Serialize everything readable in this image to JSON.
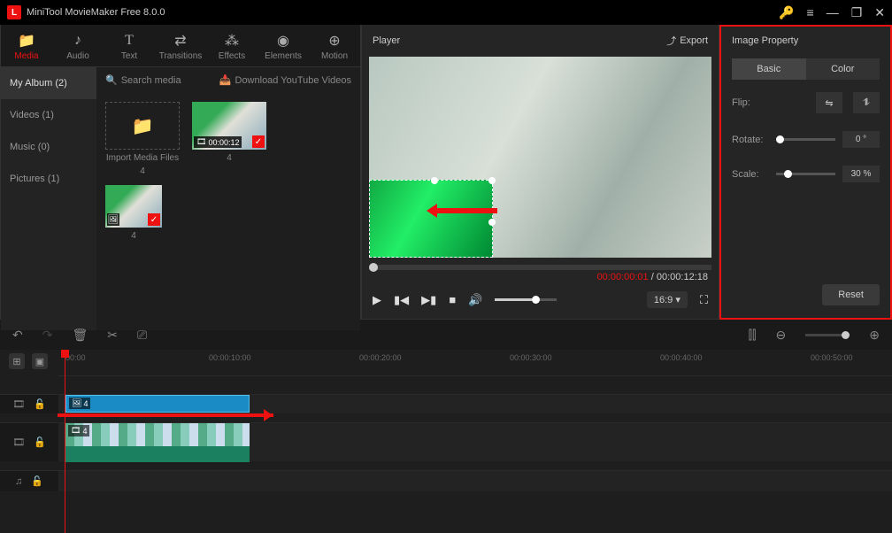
{
  "app": {
    "title": "MiniTool MovieMaker Free 8.0.0"
  },
  "toolbar_tabs": [
    {
      "id": "media",
      "label": "Media",
      "icon": "📁",
      "active": true
    },
    {
      "id": "audio",
      "label": "Audio",
      "icon": "♪"
    },
    {
      "id": "text",
      "label": "Text",
      "icon": "T"
    },
    {
      "id": "transitions",
      "label": "Transitions",
      "icon": "⇄"
    },
    {
      "id": "effects",
      "label": "Effects",
      "icon": "✨"
    },
    {
      "id": "elements",
      "label": "Elements",
      "icon": "◉"
    },
    {
      "id": "motion",
      "label": "Motion",
      "icon": "⊕"
    }
  ],
  "media_sidebar": {
    "items": [
      {
        "label": "My Album (2)",
        "active": true
      },
      {
        "label": "Videos (1)"
      },
      {
        "label": "Music (0)"
      },
      {
        "label": "Pictures (1)"
      }
    ]
  },
  "media_header": {
    "search_placeholder": "Search media",
    "download_label": "Download YouTube Videos"
  },
  "media_items": {
    "import_label": "Import Media Files",
    "import_count": "4",
    "video_duration": "00:00:12",
    "video_count": "4",
    "picture_count": "4"
  },
  "player": {
    "title": "Player",
    "export_label": "Export",
    "time_current": "00:00:00:01",
    "time_total": "00:00:12:18",
    "aspect": "16:9"
  },
  "property": {
    "title": "Image Property",
    "tabs": {
      "basic": "Basic",
      "color": "Color"
    },
    "flip_label": "Flip:",
    "rotate_label": "Rotate:",
    "rotate_value": "0 °",
    "scale_label": "Scale:",
    "scale_value": "30 %",
    "reset_label": "Reset"
  },
  "timeline": {
    "marks": [
      "00:00",
      "00:00:10:00",
      "00:00:20:00",
      "00:00:30:00",
      "00:00:40:00",
      "00:00:50:00"
    ],
    "overlay_clip_label": "4",
    "video_clip_label": "4"
  }
}
